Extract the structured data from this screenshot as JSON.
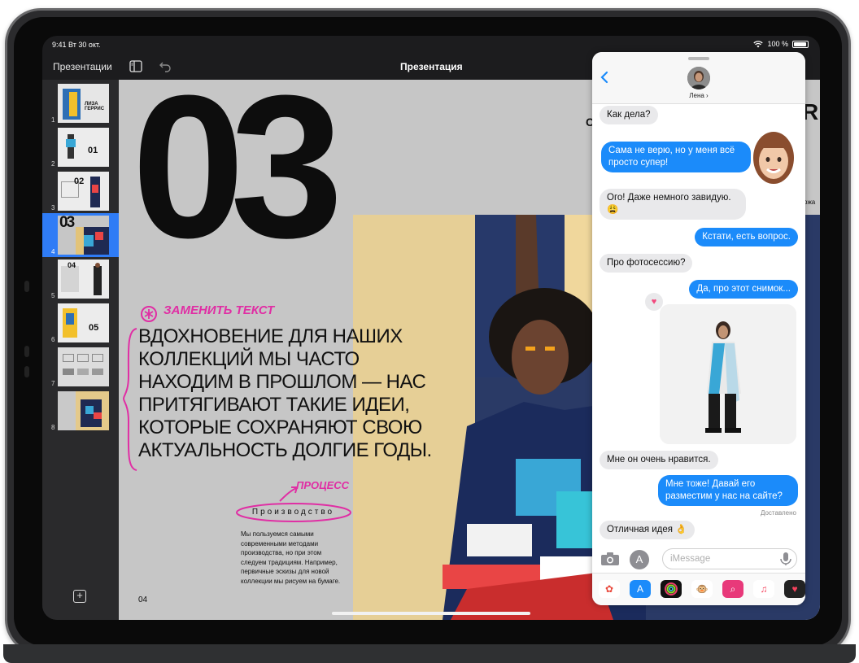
{
  "status_bar": {
    "time_date": "9:41  Вт 30 окт.",
    "battery": "100 %"
  },
  "toolbar": {
    "back_label": "Презентации",
    "title": "Презентация"
  },
  "sidebar": {
    "slides": [
      {
        "number": "1"
      },
      {
        "number": "2"
      },
      {
        "number": "3"
      },
      {
        "number": "4",
        "selected": true
      },
      {
        "number": "5"
      },
      {
        "number": "6"
      },
      {
        "number": "7"
      },
      {
        "number": "8"
      }
    ],
    "thumb_texts": {
      "t1": "ЛИЗА\nГЕРРИС",
      "t2": "01",
      "t3": "02",
      "t4": "03",
      "t5": "04",
      "t6": "05"
    }
  },
  "slide": {
    "big_number": "03",
    "annotation_replace": "ЗАМЕНИТЬ ТЕКСТ",
    "headline_lines": [
      "ВДОХНОВЕНИЕ ДЛЯ НАШИХ",
      "КОЛЛЕКЦИЙ МЫ ЧАСТО",
      "НАХОДИМ В ПРОШЛОМ — НАС",
      "ПРИТЯГИВАЮТ ТАКИЕ ИДЕИ,",
      "КОТОРЫЕ СОХРАНЯЮТ СВОЮ",
      "АКТУАЛЬНОСТЬ ДОЛГИЕ ГОДЫ."
    ],
    "annotation_process": "ПРОЦЕСС",
    "process_label": "Производство",
    "body_text": "Мы пользуемся самыми современными методами производства, но при этом следуем традициям. Например, первичные эскизы для новой коллекции мы рисуем на бумаге.",
    "page_number": "04",
    "edge_text_1": "R",
    "edge_text_2": "С",
    "edge_text_3": "ржа"
  },
  "messages": {
    "contact_name": "Лена ›",
    "conversation": [
      {
        "dir": "in",
        "text": "Как дела?"
      },
      {
        "dir": "out",
        "text": "Сама не верю, но у меня всё просто супер!"
      },
      {
        "dir": "in",
        "text": "Ого! Даже немного завидую. 😩"
      },
      {
        "dir": "out",
        "text": "Кстати, есть вопрос."
      },
      {
        "dir": "in",
        "text": "Про фотосессию?"
      },
      {
        "dir": "out",
        "text": "Да, про этот снимок..."
      },
      {
        "dir": "in",
        "text": "Мне он очень нравится."
      },
      {
        "dir": "out",
        "text": "Мне тоже! Давай его разместим у нас на сайте?"
      },
      {
        "dir": "in",
        "text": "Отличная идея 👌"
      }
    ],
    "delivered": "Доставлено",
    "input_placeholder": "iMessage",
    "tapback": "♥"
  },
  "colors": {
    "accent_blue": "#1b8bfa",
    "selection_blue": "#2f7cf6",
    "annotation_magenta": "#e02ea4"
  },
  "icons": [
    "wifi-icon",
    "battery-icon",
    "sidebar-toggle-icon",
    "undo-icon",
    "back-chevron-icon",
    "camera-icon",
    "app-store-icon",
    "microphone-icon",
    "add-slide-icon"
  ]
}
